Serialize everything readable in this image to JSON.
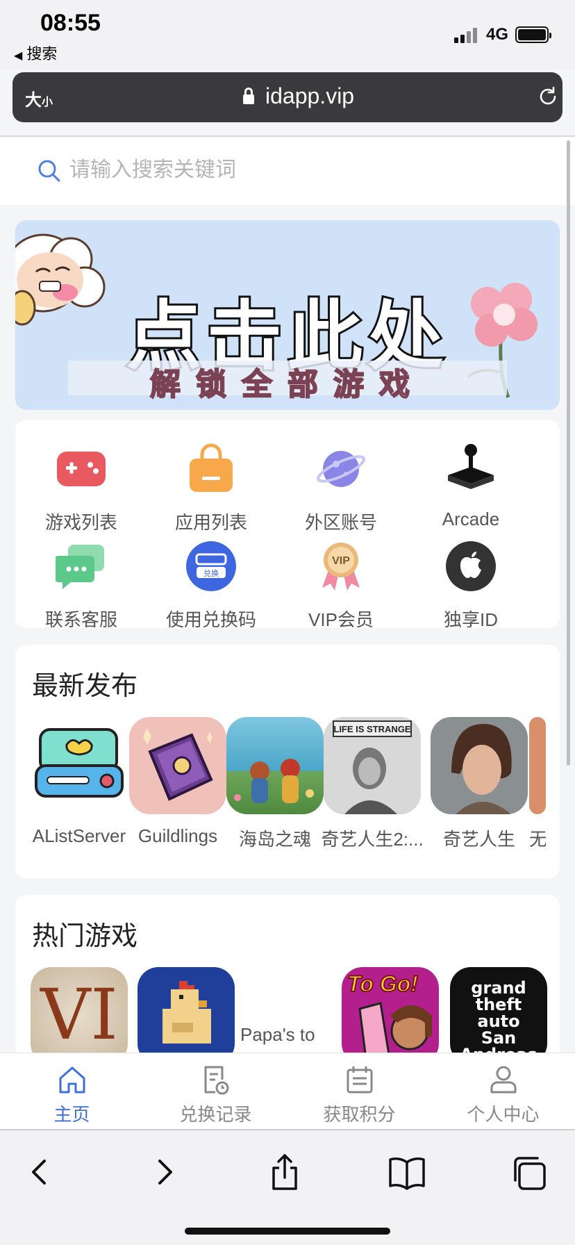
{
  "status_bar": {
    "time": "08:55",
    "back_label": "搜索",
    "network": "4G"
  },
  "browser": {
    "text_size_label": "大",
    "text_size_small": "小",
    "domain": "idapp.vip"
  },
  "search": {
    "placeholder": "请输入搜索关键词"
  },
  "banner": {
    "headline": "点击此处",
    "subline": "解锁全部游戏"
  },
  "quick_menu": [
    {
      "label": "游戏列表",
      "icon": "gamepad-icon",
      "color": "#e85a5f"
    },
    {
      "label": "应用列表",
      "icon": "shopping-bag-icon",
      "color": "#f7a84a"
    },
    {
      "label": "外区账号",
      "icon": "planet-icon",
      "color": "#8a86e8"
    },
    {
      "label": "Arcade",
      "icon": "joystick-icon",
      "color": "#111111"
    },
    {
      "label": "联系客服",
      "icon": "chat-icon",
      "color": "#5cc98b"
    },
    {
      "label": "使用兑换码",
      "icon": "redeem-code-icon",
      "color": "#3d66e0"
    },
    {
      "label": "VIP会员",
      "icon": "vip-medal-icon",
      "color": "#e9b87a"
    },
    {
      "label": "独享ID",
      "icon": "apple-icon",
      "color": "#333333"
    }
  ],
  "latest": {
    "title": "最新发布",
    "apps": [
      {
        "name": "AListServer"
      },
      {
        "name": "Guildlings"
      },
      {
        "name": "海岛之魂"
      },
      {
        "name": "奇艺人生2:..."
      },
      {
        "name": "奇艺人生"
      },
      {
        "name": "无"
      }
    ]
  },
  "hot": {
    "title": "热门游戏",
    "apps": [
      {
        "name": "",
        "art_text": "VI"
      },
      {
        "name": ""
      },
      {
        "name": "Papa's to"
      },
      {
        "name": "",
        "art_text": "To Go!"
      },
      {
        "name": "",
        "art_text": "grand theft auto San Andreas"
      }
    ]
  },
  "tab_bar": [
    {
      "label": "主页",
      "icon": "home-icon",
      "active": true
    },
    {
      "label": "兑换记录",
      "icon": "redeem-history-icon",
      "active": false
    },
    {
      "label": "获取积分",
      "icon": "points-calendar-icon",
      "active": false
    },
    {
      "label": "个人中心",
      "icon": "profile-icon",
      "active": false
    }
  ],
  "colors": {
    "accent": "#3f6fd9",
    "banner_bg": "#cfe2f8",
    "url_bar": "#3a3a3c"
  }
}
